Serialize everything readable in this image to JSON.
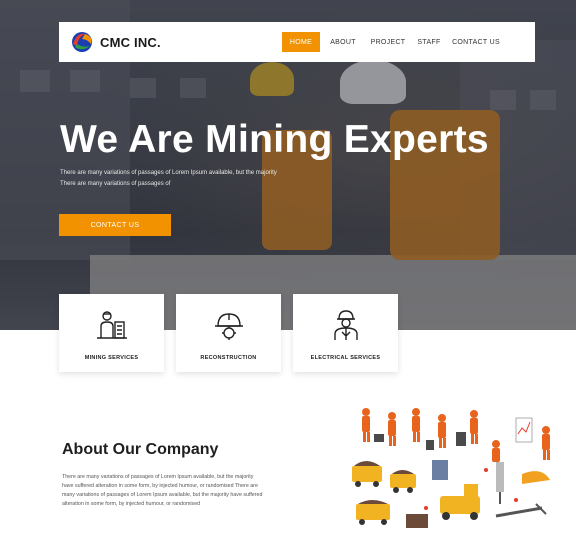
{
  "brand": {
    "name": "CMC INC."
  },
  "nav": {
    "items": [
      {
        "label": "HOME",
        "active": true
      },
      {
        "label": "ABOUT",
        "active": false
      },
      {
        "label": "PROJECT",
        "active": false
      },
      {
        "label": "STAFF",
        "active": false
      },
      {
        "label": "CONTACT US",
        "active": false
      }
    ]
  },
  "hero": {
    "title": "We Are Mining Experts",
    "line1": "There are many variations of passages of Lorem Ipsum available, but the majority",
    "line2": "There are many variations of passages of",
    "cta_label": "CONTACT US"
  },
  "services": [
    {
      "label": "MINING SERVICES",
      "icon": "miner-icon"
    },
    {
      "label": "RECONSTRUCTION",
      "icon": "helmet-gear-icon"
    },
    {
      "label": "ELECTRICAL SERVICES",
      "icon": "engineer-icon"
    }
  ],
  "about": {
    "title": "About Our Company",
    "lines": [
      "There are many variations of passages of Lorem Ipsum available, but the majority",
      "have suffered alteration in some form, by injected humour, or randomised There are",
      "many variations of passages of Lorem Ipsum available, but the majority have suffered",
      "alteration in some form, by injected humour, or randomised",
      ""
    ]
  },
  "colors": {
    "accent": "#f39200",
    "hero_overlay": "#3d4048",
    "text_dark": "#1f1f1f"
  }
}
